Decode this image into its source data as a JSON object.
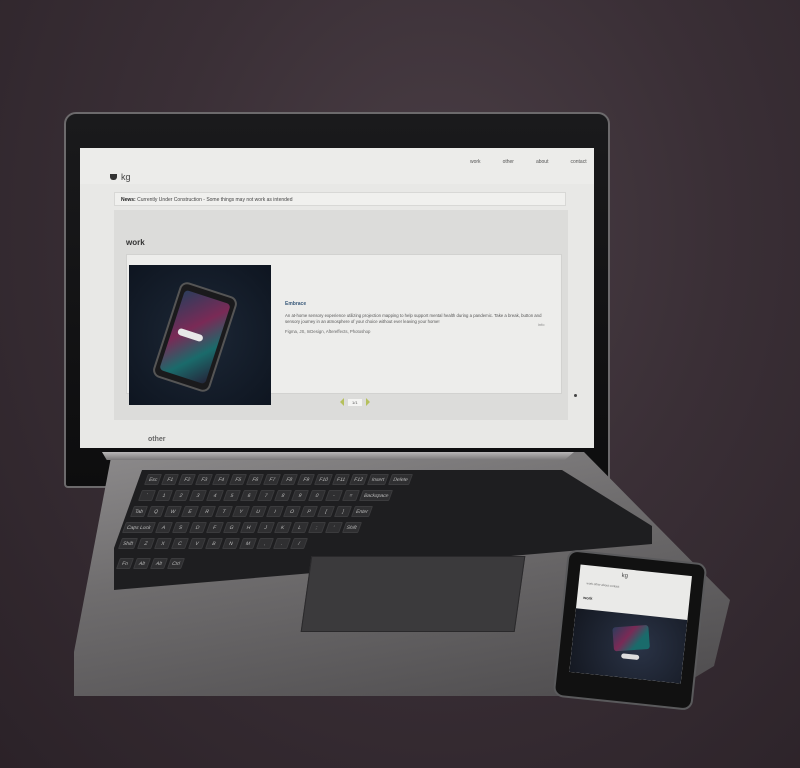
{
  "site": {
    "logo": "kg",
    "nav": [
      "work",
      "other",
      "about",
      "contact"
    ],
    "notice_label": "News:",
    "notice_text": "Currently Under Construction - Some things may not work as intended",
    "section_title": "work",
    "project": {
      "title": "Embrace",
      "description": "An at-home sensory experience utilizing projection mapping to help support mental health during a pandemic. Take a break, button and sensory journey in an atmosphere of your choice without ever leaving your home!",
      "tags": "Figma, JS, InDesign, Aftereffects, Photoshop",
      "more": "info"
    },
    "pager_label": "1/1",
    "next_section": "other"
  },
  "mobile": {
    "logo": "kg",
    "nav_text": "work other about contact",
    "section_title": "work"
  },
  "keyboard": {
    "row1": [
      "Esc",
      "F1",
      "F2",
      "F3",
      "F4",
      "F5",
      "F6",
      "F7",
      "F8",
      "F9",
      "F10",
      "F11",
      "F12",
      "Insert",
      "Delete"
    ],
    "row2": [
      "`",
      "1",
      "2",
      "3",
      "4",
      "5",
      "6",
      "7",
      "8",
      "9",
      "0",
      "-",
      "=",
      "Backspace"
    ],
    "row3": [
      "Tab",
      "Q",
      "W",
      "E",
      "R",
      "T",
      "Y",
      "U",
      "I",
      "O",
      "P",
      "[",
      "]",
      "Enter"
    ],
    "row4": [
      "Caps Lock",
      "A",
      "S",
      "D",
      "F",
      "G",
      "H",
      "J",
      "K",
      "L",
      ";",
      "'",
      "Shift"
    ],
    "row5": [
      "Shift",
      "Z",
      "X",
      "C",
      "V",
      "B",
      "N",
      "M",
      ",",
      ".",
      "/"
    ],
    "row6": [
      "Fn",
      "Alt",
      "Alt",
      "Ctrl"
    ]
  }
}
